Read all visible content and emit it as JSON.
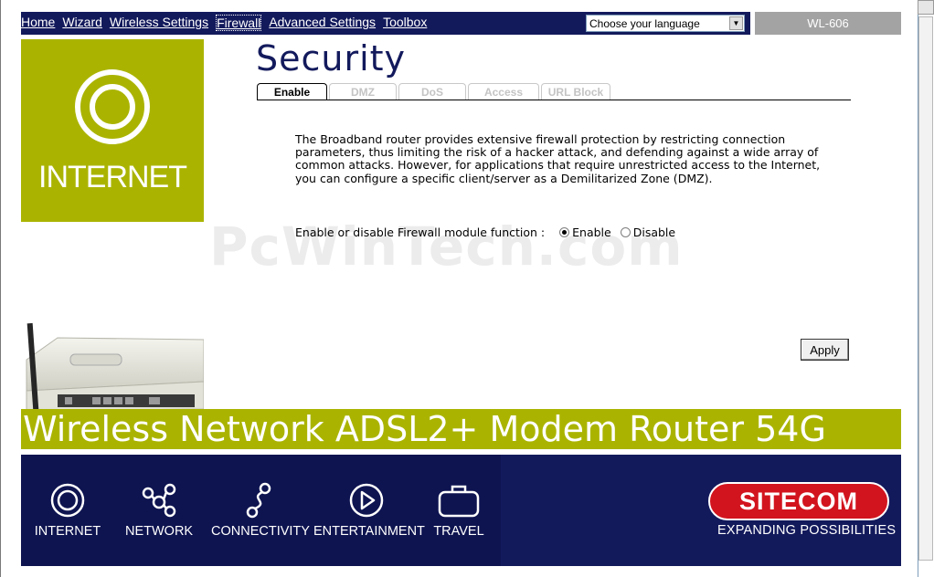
{
  "nav": {
    "links": [
      "Home",
      "Wizard",
      "Wireless Settings",
      "Firewall",
      "Advanced Settings",
      "Toolbox"
    ],
    "active": "Firewall",
    "language_select": "Choose your language",
    "model": "WL-606"
  },
  "brand_tile": {
    "label": "INTERNET",
    "icon": "internet-ring-icon"
  },
  "page": {
    "title": "Security",
    "tabs": [
      "Enable",
      "DMZ",
      "DoS",
      "Access",
      "URL Block"
    ],
    "active_tab": "Enable",
    "description": "The Broadband router provides extensive firewall protection by restricting connection parameters, thus limiting the risk of a hacker attack, and defending against a wide array of common attacks. However, for applications that require unrestricted access to the Internet, you can configure a specific client/server as a Demilitarized Zone (DMZ).",
    "firewall_label": "Enable or disable Firewall module function :",
    "option_enable": "Enable",
    "option_disable": "Disable",
    "firewall_selected": "Enable",
    "apply_label": "Apply"
  },
  "watermark": "PcWinTech.com",
  "banner": {
    "text": "Wireless Network ADSL2+ Modem Router 54G"
  },
  "footer": {
    "items": [
      {
        "label": "INTERNET",
        "icon": "internet-icon"
      },
      {
        "label": "NETWORK",
        "icon": "network-icon"
      },
      {
        "label": "CONNECTIVITY",
        "icon": "connectivity-icon"
      },
      {
        "label": "ENTERTAINMENT",
        "icon": "play-icon"
      },
      {
        "label": "TRAVEL",
        "icon": "suitcase-icon"
      }
    ],
    "brand": "SITECOM",
    "tagline": "EXPANDING POSSIBILITIES"
  },
  "colors": {
    "navy": "#131a5c",
    "olive": "#aab400",
    "grey_model": "#a3a3a3",
    "brand_red": "#d2141e"
  }
}
